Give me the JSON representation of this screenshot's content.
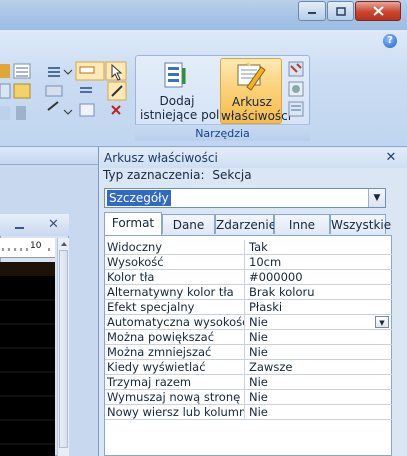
{
  "ribbon": {
    "add_fields_label": "Dodaj\nistniejące pola",
    "property_sheet_label": "Arkusz\nwłaściwości",
    "group_label": "Narzędzia"
  },
  "left": {
    "ruler_mark": "10",
    "close_glyph": "✕"
  },
  "property_sheet": {
    "title": "Arkusz właściwości",
    "selection_type_label": "Typ zaznaczenia:",
    "selection_type_value": "Sekcja",
    "selected_object": "Szczegóły",
    "tabs": [
      {
        "label": "Format",
        "active": true
      },
      {
        "label": "Dane"
      },
      {
        "label": "Zdarzenie"
      },
      {
        "label": "Inne"
      },
      {
        "label": "Wszystkie"
      }
    ],
    "rows": [
      {
        "name": "Widoczny",
        "value": "Tak"
      },
      {
        "name": "Wysokość",
        "value": "10cm"
      },
      {
        "name": "Kolor tła",
        "value": "#000000"
      },
      {
        "name": "Alternatywny kolor tła",
        "value": "Brak koloru"
      },
      {
        "name": "Efekt specjalny",
        "value": "Płaski"
      },
      {
        "name": "Automatyczna wysokość",
        "value": "Nie"
      },
      {
        "name": "Można powiększać",
        "value": "Nie"
      },
      {
        "name": "Można zmniejszać",
        "value": "Nie"
      },
      {
        "name": "Kiedy wyświetlać",
        "value": "Zawsze"
      },
      {
        "name": "Trzymaj razem",
        "value": "Nie"
      },
      {
        "name": "Wymuszaj nową stronę",
        "value": "Nie"
      },
      {
        "name": "Nowy wiersz lub kolumna",
        "value": "Nie"
      }
    ]
  },
  "colors": {
    "accent": "#3169c6",
    "ribbon_active": "#fbd27a"
  }
}
